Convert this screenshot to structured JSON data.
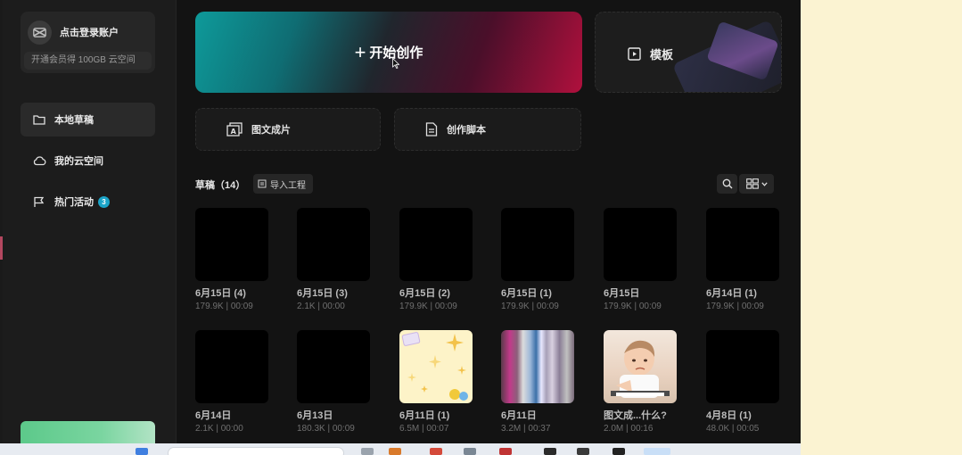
{
  "sidebar": {
    "login_text": "点击登录账户",
    "vip_text": "开通会员得 100GB 云空间",
    "nav": [
      {
        "label": "本地草稿",
        "active": true
      },
      {
        "label": "我的云空间",
        "active": false
      },
      {
        "label": "热门活动",
        "active": false,
        "badge": "3"
      }
    ]
  },
  "main": {
    "create_label": "开始创作",
    "template_label": "模板",
    "actions": [
      "图文成片",
      "创作脚本"
    ],
    "drafts_title": "草稿（14）",
    "import_label": "导入工程",
    "drafts": [
      {
        "name": "6月15日 (4)",
        "meta": "179.9K | 00:09",
        "thumb": "black"
      },
      {
        "name": "6月15日 (3)",
        "meta": "2.1K | 00:00",
        "thumb": "black"
      },
      {
        "name": "6月15日 (2)",
        "meta": "179.9K | 00:09",
        "thumb": "black"
      },
      {
        "name": "6月15日 (1)",
        "meta": "179.9K | 00:09",
        "thumb": "black"
      },
      {
        "name": "6月15日",
        "meta": "179.9K | 00:09",
        "thumb": "black"
      },
      {
        "name": "6月14日 (1)",
        "meta": "179.9K | 00:09",
        "thumb": "black"
      },
      {
        "name": "6月14日",
        "meta": "2.1K | 00:00",
        "thumb": "black"
      },
      {
        "name": "6月13日",
        "meta": "180.3K | 00:09",
        "thumb": "black"
      },
      {
        "name": "6月11日 (1)",
        "meta": "6.5M | 00:07",
        "thumb": "sparkle"
      },
      {
        "name": "6月11日",
        "meta": "3.2M | 00:37",
        "thumb": "glitch"
      },
      {
        "name": "图文成...什么?",
        "meta": "2.0M | 00:16",
        "thumb": "kid"
      },
      {
        "name": "4月8日 (1)",
        "meta": "48.0K | 00:05",
        "thumb": "black"
      }
    ]
  },
  "colors": {
    "background": "#131313",
    "accent_teal": "#0e9a9a",
    "accent_red": "#b0103d",
    "badge": "#1ba4c8"
  }
}
